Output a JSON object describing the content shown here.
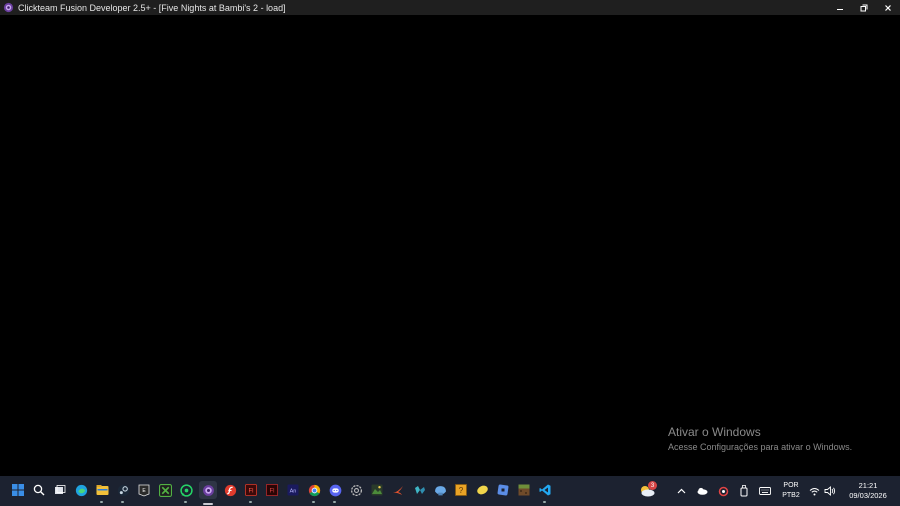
{
  "window": {
    "title": "Clickteam Fusion Developer 2.5+ - [Five Nights at Bambi's 2 - load]",
    "app_icon": "clickteam-fusion-icon",
    "controls": {
      "minimize": "minimize-icon",
      "restore": "restore-icon",
      "close": "close-icon"
    }
  },
  "watermark": {
    "line1": "Ativar o Windows",
    "line2": "Acesse Configurações para ativar o Windows."
  },
  "taskbar": {
    "pinned": [
      {
        "name": "start-icon",
        "color": "#3a8ee6"
      },
      {
        "name": "search-icon",
        "color": "#ffffff"
      },
      {
        "name": "task-view-icon",
        "color": "#ffffff"
      },
      {
        "name": "edge-icon",
        "color": "#1fa3e0"
      },
      {
        "name": "file-explorer-icon",
        "color": "#f3c13a"
      },
      {
        "name": "steam-icon",
        "color": "#c7d5e0"
      },
      {
        "name": "epic-games-icon",
        "color": "#e6e6e6"
      },
      {
        "name": "xbox-icon",
        "color": "#52b043"
      },
      {
        "name": "whatsapp-icon",
        "color": "#25d366"
      },
      {
        "name": "clickteam-fusion-icon",
        "color": "#9b59d0"
      },
      {
        "name": "flash-player-icon",
        "color": "#e03b2d"
      },
      {
        "name": "flash-icon",
        "color": "#d83a2a"
      },
      {
        "name": "flash-cs-icon",
        "color": "#b3282b"
      },
      {
        "name": "animate-icon",
        "color": "#1a1a5e"
      },
      {
        "name": "chrome-icon",
        "color": "#e9b43c"
      },
      {
        "name": "discord-icon",
        "color": "#5865f2"
      },
      {
        "name": "settings-icon",
        "color": "#bcbcbc"
      },
      {
        "name": "image-app-icon",
        "color": "#4c8b3a"
      },
      {
        "name": "swift-app-icon",
        "color": "#e8542e"
      },
      {
        "name": "game-controller-icon",
        "color": "#3fb6c6"
      },
      {
        "name": "blender-app-icon",
        "color": "#6aa9e6"
      },
      {
        "name": "question-block-icon",
        "color": "#e9a326"
      },
      {
        "name": "lemon-app-icon",
        "color": "#f1d54b"
      },
      {
        "name": "roblox-icon",
        "color": "#5b8de6"
      },
      {
        "name": "minecraft-icon",
        "color": "#6f8f3a"
      },
      {
        "name": "vscode-icon",
        "color": "#23a9f2"
      }
    ],
    "weather_badge": "3",
    "tray_icons": [
      "chevron-up-icon",
      "onedrive-icon",
      "cloud-sync-icon",
      "usb-icon",
      "keyboard-icon",
      "wifi-icon",
      "volume-icon"
    ],
    "language": {
      "line1": "POR",
      "line2": "PTB2"
    },
    "clock": {
      "time": "21:21",
      "date": "09/03/2026"
    }
  }
}
